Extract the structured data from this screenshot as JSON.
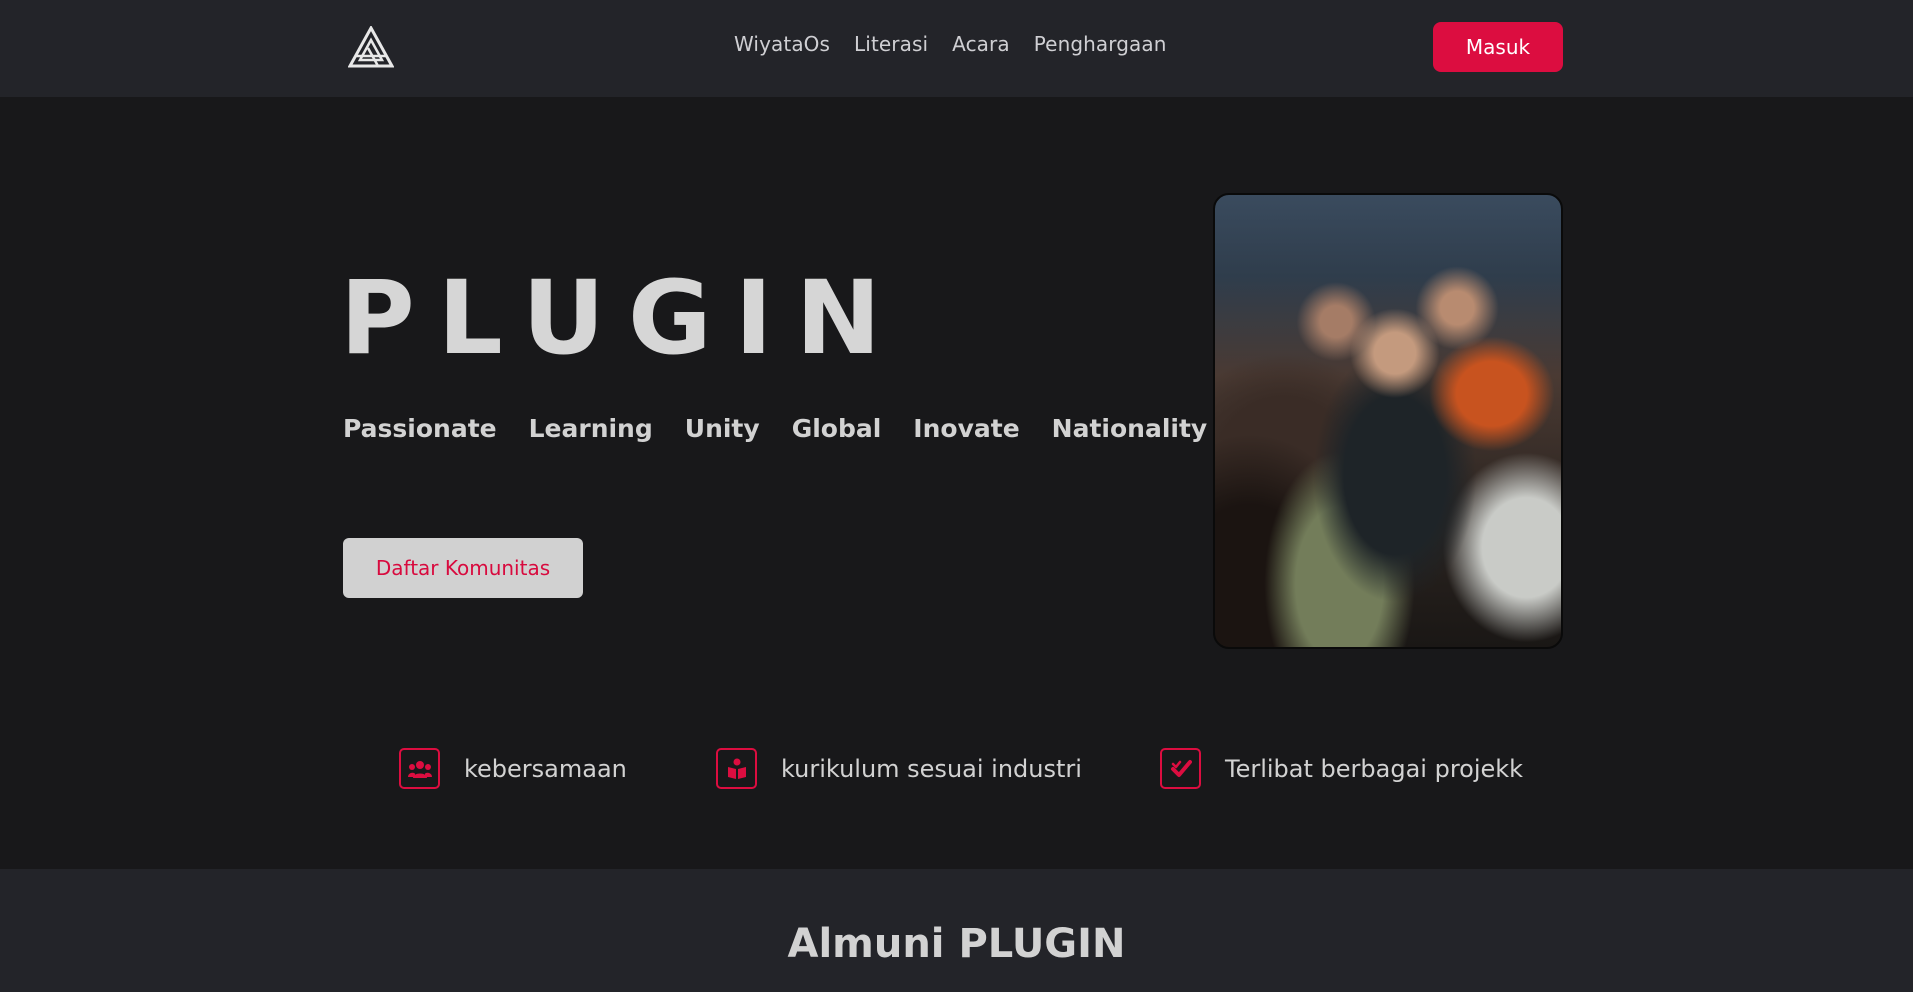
{
  "header": {
    "nav": [
      "WiyataOs",
      "Literasi",
      "Acara",
      "Penghargaan"
    ],
    "login_label": "Masuk"
  },
  "hero": {
    "title": "PLUGIN",
    "values": [
      "Passionate",
      "Learning",
      "Unity",
      "Global",
      "Inovate",
      "Nationality"
    ],
    "cta_label": "Daftar Komunitas"
  },
  "features": [
    {
      "icon": "users-icon",
      "label": "kebersamaan"
    },
    {
      "icon": "book-reader-icon",
      "label": "kurikulum sesuai industri"
    },
    {
      "icon": "check-square-icon",
      "label": "Terlibat berbagai projekk"
    }
  ],
  "alumni": {
    "title": "Almuni PLUGIN"
  },
  "colors": {
    "accent": "#dc0d40",
    "header_bg": "#232429",
    "page_bg": "#18181a",
    "text": "#d2d2d2"
  }
}
